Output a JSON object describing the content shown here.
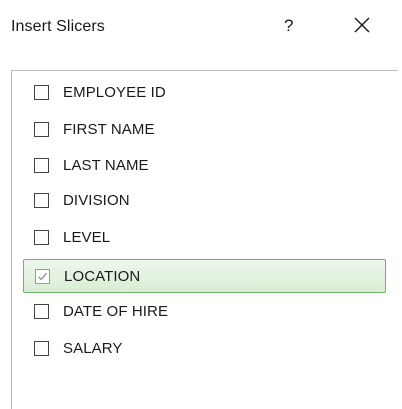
{
  "dialog": {
    "title": "Insert Slicers",
    "help_label": "?",
    "close_icon": "close-icon"
  },
  "fields": [
    {
      "label": "EMPLOYEE ID",
      "checked": false,
      "selected": false
    },
    {
      "label": "FIRST NAME",
      "checked": false,
      "selected": false
    },
    {
      "label": "LAST NAME",
      "checked": false,
      "selected": false
    },
    {
      "label": "DIVISION",
      "checked": false,
      "selected": false
    },
    {
      "label": "LEVEL",
      "checked": false,
      "selected": false
    },
    {
      "label": "LOCATION",
      "checked": true,
      "selected": true
    },
    {
      "label": "DATE OF HIRE",
      "checked": false,
      "selected": false
    },
    {
      "label": "SALARY",
      "checked": false,
      "selected": false
    }
  ],
  "colors": {
    "selection_border": "#6fb46a",
    "selection_fill": "#d8eed3",
    "checkmark": "#9a9a9a"
  }
}
